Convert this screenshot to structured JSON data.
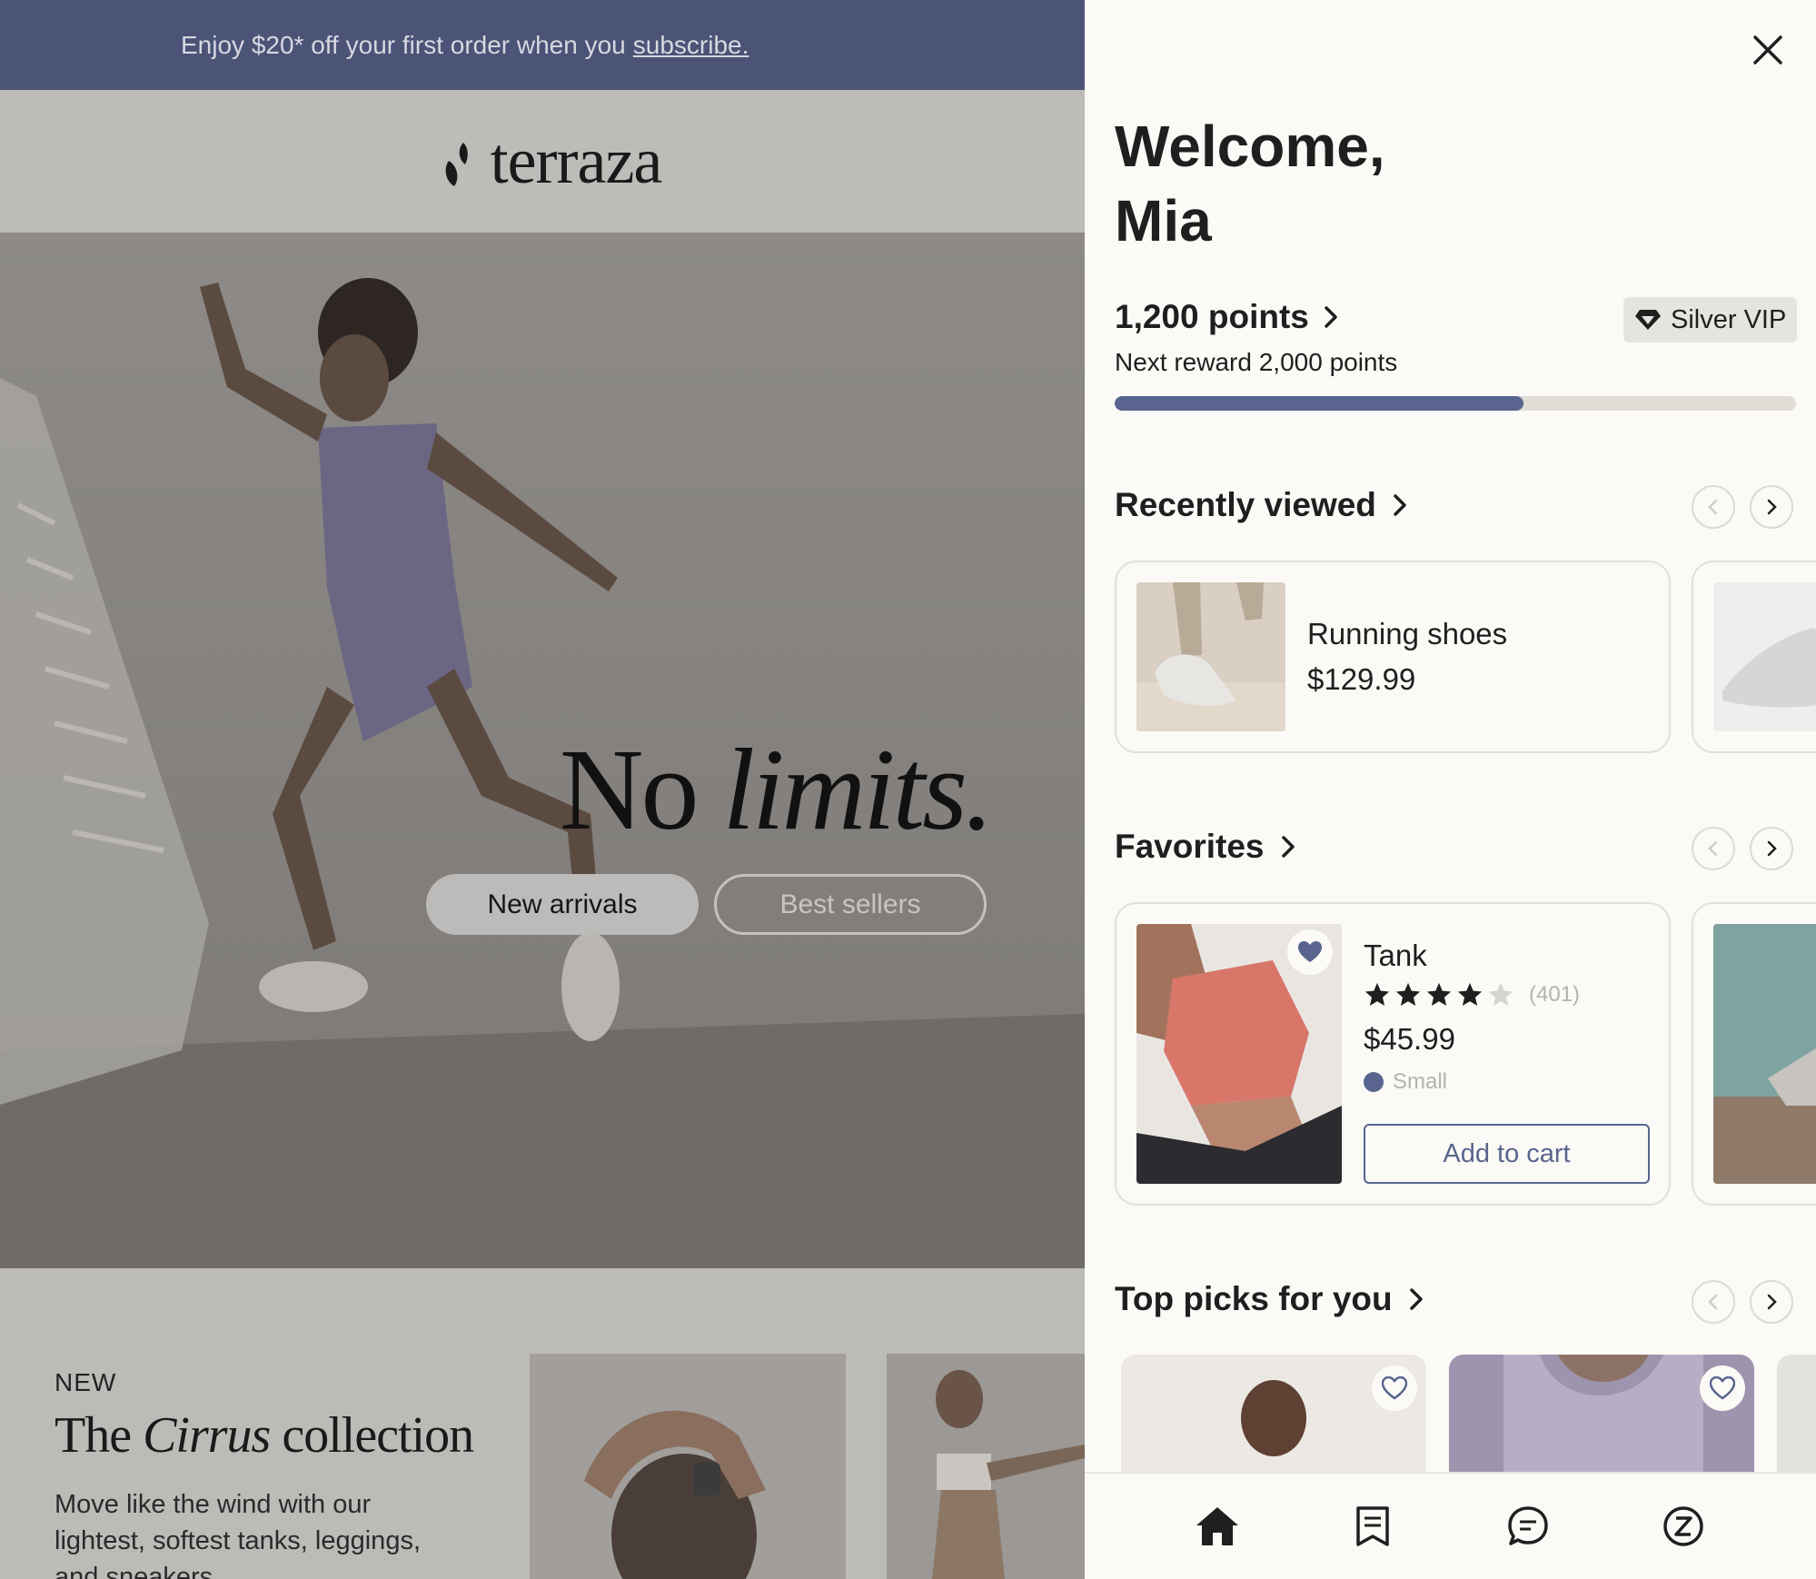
{
  "promo": {
    "text": "Enjoy $20* off your first order when you",
    "link": "subscribe."
  },
  "brand": {
    "name": "terraza",
    "logo_icon": "leaf-logo-icon"
  },
  "hero": {
    "headline_plain": "No",
    "headline_italic": "limits.",
    "primary_button": "New arrivals",
    "secondary_button": "Best sellers"
  },
  "collection": {
    "kicker": "NEW",
    "title_prefix": "The",
    "title_italic": "Cirrus",
    "title_suffix": "collection",
    "description": "Move like the wind with our lightest, softest tanks, leggings, and sneakers"
  },
  "drawer": {
    "close_icon": "close-icon",
    "welcome": "Welcome, Mia",
    "points": "1,200 points",
    "next_reward": "Next reward 2,000 points",
    "progress_fraction": 0.6,
    "vip_badge": "Silver VIP",
    "vip_icon": "diamond-icon",
    "colors": {
      "accent": "#59658e",
      "progress_track": "#e0ddd7",
      "background": "#fbfaf6"
    }
  },
  "recently_viewed": {
    "title": "Recently viewed",
    "items": [
      {
        "name": "Running shoes",
        "price": "$129.99"
      }
    ]
  },
  "favorites": {
    "title": "Favorites",
    "items": [
      {
        "name": "Tank",
        "rating": 4,
        "rating_max": 5,
        "reviews": "(401)",
        "price": "$45.99",
        "size": "Small",
        "cta": "Add to cart"
      }
    ]
  },
  "top_picks": {
    "title": "Top picks for you"
  },
  "bottom_nav": {
    "items": [
      "home-icon",
      "orders-icon",
      "chat-icon",
      "rewards-icon"
    ]
  }
}
